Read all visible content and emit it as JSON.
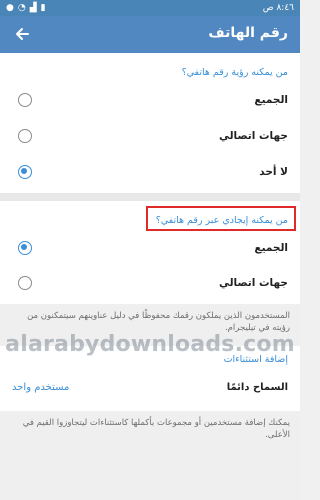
{
  "status_bar": {
    "time": "٨:٤٦ ص",
    "icons": [
      "battery-icon",
      "signal-icon",
      "wifi-icon",
      "notification-icon"
    ]
  },
  "app_bar": {
    "title": "رقم الهاتف",
    "back_icon": "arrow-left-icon",
    "color": "#5288c1"
  },
  "section_who_can_see": {
    "header": "من يمكنه رؤية رقم هاتفي؟",
    "options": [
      {
        "label": "الجميع",
        "selected": false
      },
      {
        "label": "جهات اتصالي",
        "selected": false
      },
      {
        "label": "لا أحد",
        "selected": true
      }
    ]
  },
  "section_who_can_find": {
    "header": "من يمكنه إيجادي عبر رقم هاتفي؟",
    "options": [
      {
        "label": "الجميع",
        "selected": true
      },
      {
        "label": "جهات اتصالي",
        "selected": false
      }
    ],
    "info": "المستخدمون الذين يملكون رقمك محفوظًا في دليل عناوينهم سيتمكنون من رؤيته في تيليجرام."
  },
  "section_exceptions": {
    "header": "إضافة استثناءات",
    "setting_name": "السماح دائمًا",
    "setting_value": "مستخدم واحد",
    "info": "يمكنك إضافة مستخدمين أو مجموعات بأكملها كاستثناءات ليتجاوزوا القيم في الأعلى."
  },
  "watermark": "alarabydownloads.com",
  "accent_color": "#3a8ed8"
}
